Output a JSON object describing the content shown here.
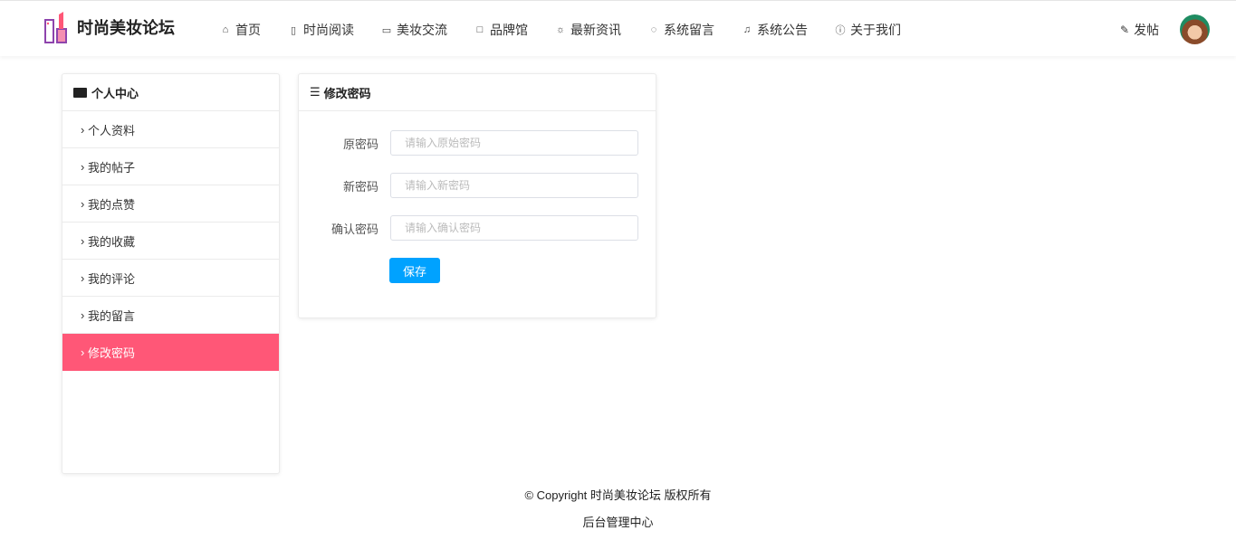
{
  "colors": {
    "accent": "#ff5777",
    "primary": "#00a2ff",
    "logo": "#8e44ad"
  },
  "header": {
    "title": "时尚美妆论坛",
    "post_label": "发帖",
    "nav": [
      {
        "label": "首页",
        "icon": "home-icon"
      },
      {
        "label": "时尚阅读",
        "icon": "book-icon"
      },
      {
        "label": "美妆交流",
        "icon": "message-icon"
      },
      {
        "label": "品牌馆",
        "icon": "shop-icon"
      },
      {
        "label": "最新资讯",
        "icon": "sun-icon"
      },
      {
        "label": "系统留言",
        "icon": "chat-icon"
      },
      {
        "label": "系统公告",
        "icon": "bell-icon"
      },
      {
        "label": "关于我们",
        "icon": "info-icon"
      }
    ]
  },
  "sidebar": {
    "title": "个人中心",
    "items": [
      "个人资料",
      "我的帖子",
      "我的点赞",
      "我的收藏",
      "我的评论",
      "我的留言",
      "修改密码"
    ],
    "active": "修改密码"
  },
  "form": {
    "title": "修改密码",
    "fields": [
      {
        "label": "原密码",
        "placeholder": "请输入原始密码"
      },
      {
        "label": "新密码",
        "placeholder": "请输入新密码"
      },
      {
        "label": "确认密码",
        "placeholder": "请输入确认密码"
      }
    ],
    "save_label": "保存"
  },
  "footer": {
    "copyright": "© Copyright 时尚美妆论坛 版权所有",
    "admin_link": "后台管理中心"
  }
}
